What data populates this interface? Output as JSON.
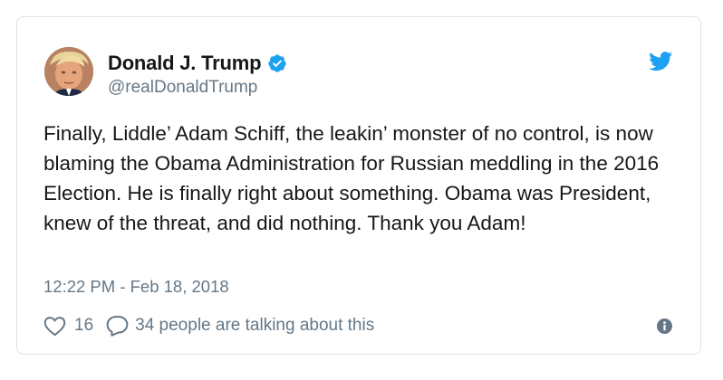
{
  "user": {
    "display_name": "Donald J. Trump",
    "handle": "@realDonaldTrump",
    "verified": true
  },
  "tweet": {
    "text": "Finally, Liddle’ Adam Schiff, the leakin’ monster of no control, is now blaming the Obama Administration for Russian meddling in the 2016 Election. He is finally right about something. Obama was President, knew of the threat, and did nothing. Thank you Adam!",
    "timestamp": "12:22 PM - Feb 18, 2018"
  },
  "actions": {
    "like_count": "16",
    "talking_label": "34 people are talking about this"
  },
  "icons": {
    "verified": "verified-badge-icon",
    "brand": "twitter-bird-icon",
    "like": "heart-icon",
    "reply": "speech-bubble-icon",
    "info": "info-icon"
  },
  "colors": {
    "brand_blue": "#1da1f2",
    "text_primary": "#14171a",
    "text_secondary": "#657786",
    "border": "#dfe3e7"
  }
}
